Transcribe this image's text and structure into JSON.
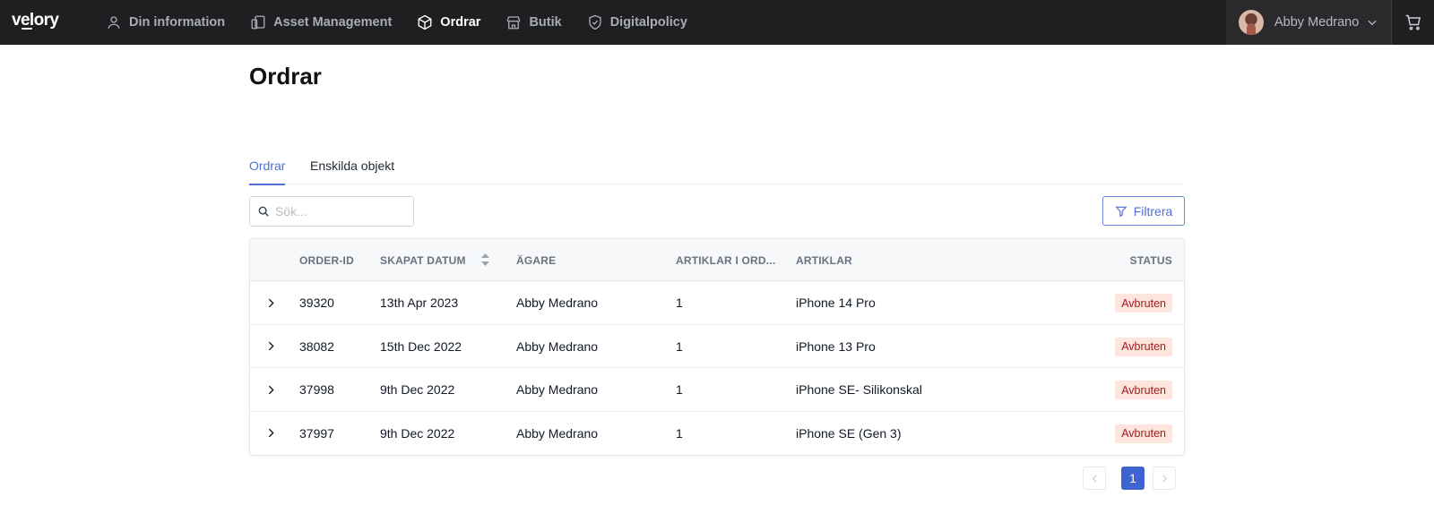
{
  "app": {
    "logo_text": "velory"
  },
  "nav": {
    "items": [
      {
        "label": "Din information",
        "icon": "user-icon",
        "active": false
      },
      {
        "label": "Asset Management",
        "icon": "devices-icon",
        "active": false
      },
      {
        "label": "Ordrar",
        "icon": "box-icon",
        "active": true
      },
      {
        "label": "Butik",
        "icon": "store-icon",
        "active": false
      },
      {
        "label": "Digitalpolicy",
        "icon": "shield-icon",
        "active": false
      }
    ],
    "user_name": "Abby Medrano"
  },
  "page": {
    "title": "Ordrar"
  },
  "tabs": [
    {
      "label": "Ordrar",
      "active": true
    },
    {
      "label": "Enskilda objekt",
      "active": false
    }
  ],
  "search": {
    "placeholder": "Sök...",
    "value": ""
  },
  "filter": {
    "label": "Filtrera"
  },
  "table": {
    "columns": [
      "ORDER-ID",
      "SKAPAT DATUM",
      "ÄGARE",
      "ARTIKLAR I ORD...",
      "ARTIKLAR",
      "STATUS"
    ],
    "rows": [
      {
        "order_id": "39320",
        "date": "13th Apr 2023",
        "owner": "Abby Medrano",
        "count": "1",
        "items": "iPhone 14 Pro",
        "status": "Avbruten"
      },
      {
        "order_id": "38082",
        "date": "15th Dec 2022",
        "owner": "Abby Medrano",
        "count": "1",
        "items": "iPhone 13 Pro",
        "status": "Avbruten"
      },
      {
        "order_id": "37998",
        "date": "9th Dec 2022",
        "owner": "Abby Medrano",
        "count": "1",
        "items": "iPhone SE- Silikonskal",
        "status": "Avbruten"
      },
      {
        "order_id": "37997",
        "date": "9th Dec 2022",
        "owner": "Abby Medrano",
        "count": "1",
        "items": "iPhone SE (Gen 3)",
        "status": "Avbruten"
      }
    ]
  },
  "pagination": {
    "current_page": "1"
  },
  "colors": {
    "accent": "#4f6fd6",
    "nav_bg": "#1f1f21",
    "badge_bg": "#fde4dc",
    "badge_text": "#9b1c1c"
  }
}
